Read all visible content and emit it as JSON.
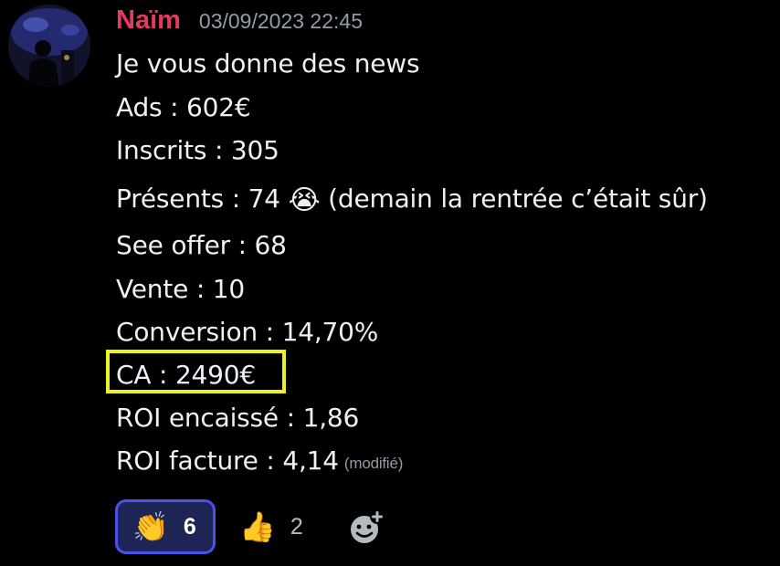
{
  "message": {
    "author": "Naïm",
    "timestamp": "03/09/2023 22:45",
    "author_color": "#e23b5d",
    "lines": {
      "l0": "Je vous donne des news",
      "l1": "Ads : 602€",
      "l2": "Inscrits : 305",
      "l3_before": "Présents : 74 ",
      "l3_emoji": "😭",
      "l3_after": " (demain la rentrée c’était sûr)",
      "l4": "See offer : 68",
      "l5": "Vente : 10",
      "l6": "Conversion : 14,70%",
      "l7": "CA : 2490€",
      "l8": "ROI encaissé : 1,86",
      "l9": "ROI facture : 4,14"
    },
    "edited_label": "(modifié)",
    "highlight_color": "#ecf21c"
  },
  "reactions": {
    "clap": {
      "emoji": "👏",
      "count": "6",
      "active": true
    },
    "thumbs_up": {
      "emoji": "👍",
      "count": "2",
      "active": false
    },
    "add_reaction_icon": "add-reaction-icon"
  },
  "colors": {
    "background": "#000000",
    "text": "#eef0f3",
    "muted": "#949ba4",
    "reaction_active_bg": "#1f2456",
    "reaction_active_border": "#4654e8"
  }
}
